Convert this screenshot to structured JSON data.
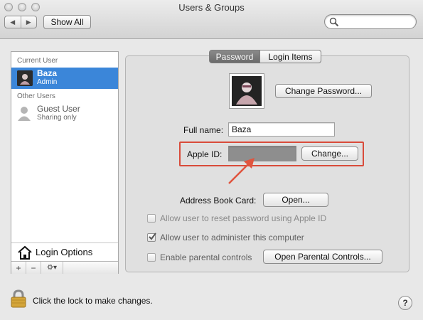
{
  "window": {
    "title": "Users & Groups"
  },
  "toolbar": {
    "back_glyph": "◀",
    "forward_glyph": "▶",
    "show_all_label": "Show All",
    "search_placeholder": ""
  },
  "sidebar": {
    "current_user_heading": "Current User",
    "current_user": {
      "name": "Baza",
      "role": "Admin"
    },
    "other_users_heading": "Other Users",
    "other_users": [
      {
        "name": "Guest User",
        "role": "Sharing only"
      }
    ],
    "login_options_label": "Login Options",
    "add_label": "+",
    "remove_label": "−",
    "action_label": "⚙▾"
  },
  "tabs": [
    {
      "label": "Password",
      "active": true
    },
    {
      "label": "Login Items",
      "active": false
    }
  ],
  "account": {
    "change_password_label": "Change Password...",
    "full_name_label": "Full name:",
    "full_name_value": "Baza",
    "apple_id_label": "Apple ID:",
    "apple_id_value": "",
    "change_label": "Change...",
    "address_book_label": "Address Book Card:",
    "open_label": "Open...",
    "checkboxes": [
      {
        "label": "Allow user to reset password using Apple ID",
        "checked": false,
        "enabled": false
      },
      {
        "label": "Allow user to administer this computer",
        "checked": true,
        "enabled": false
      },
      {
        "label": "Enable parental controls",
        "checked": false,
        "enabled": false
      }
    ],
    "parental_controls_button": "Open Parental Controls..."
  },
  "footer": {
    "lock_text": "Click the lock to make changes.",
    "help_label": "?"
  },
  "colors": {
    "selection": "#3b86d9",
    "highlight_box": "#d94b3a",
    "apple_id_redaction": "#8e8e8e"
  }
}
